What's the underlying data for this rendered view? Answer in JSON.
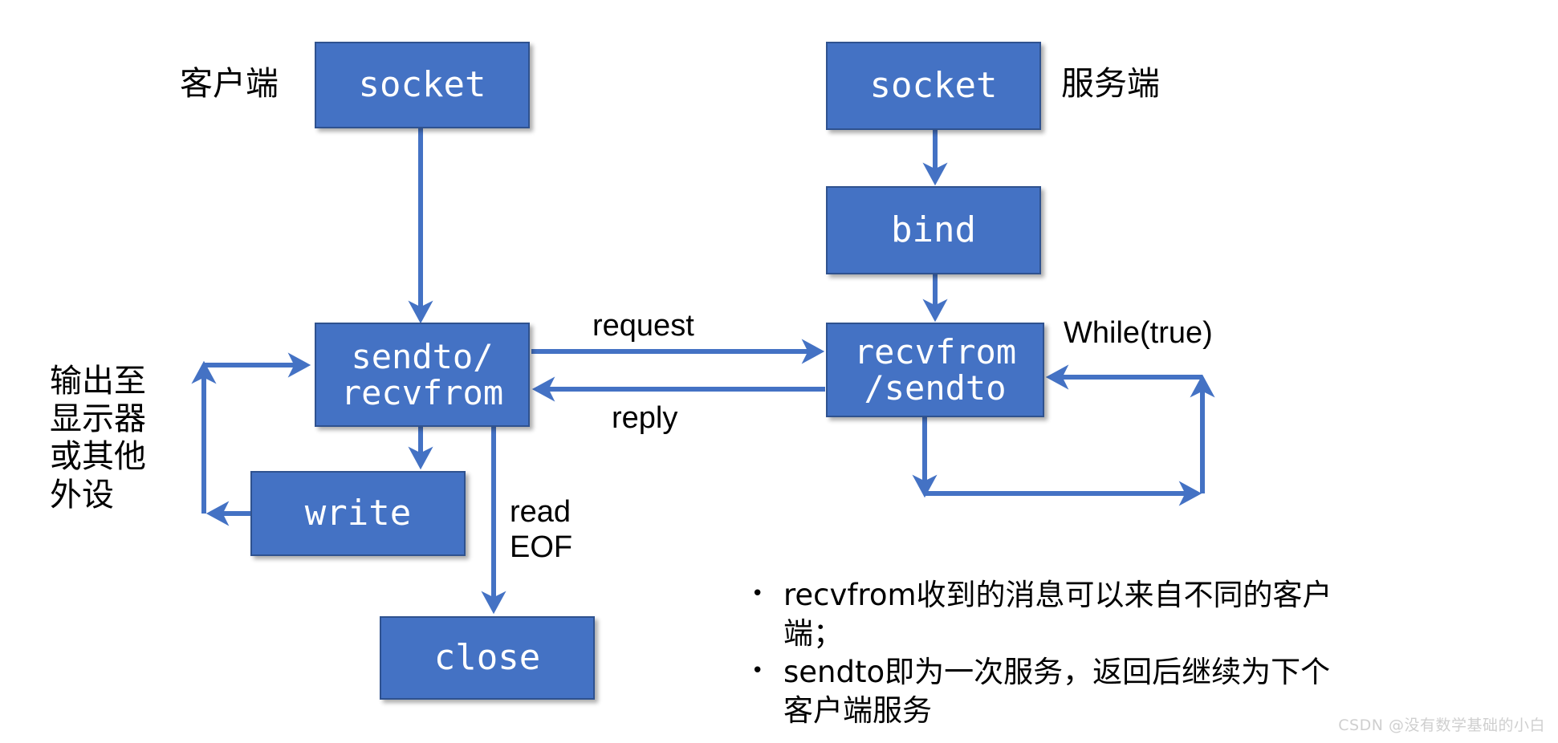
{
  "diagram": {
    "title": "UDP socket client-server flow",
    "colors": {
      "box_fill": "#4472C4",
      "box_border": "#2F528F",
      "arrow": "#4472C4",
      "text_dark": "#000000",
      "box_text": "#FFFFFF",
      "watermark": "#CFCFCF",
      "background": "#FFFFFF"
    },
    "side_labels": {
      "client": "客户端",
      "server": "服务端"
    },
    "nodes": {
      "client_socket": "socket",
      "client_sendto_recvfrom": "sendto/\nrecvfrom",
      "client_write": "write",
      "client_close": "close",
      "server_socket": "socket",
      "server_bind": "bind",
      "server_recvfrom_sendto": "recvfrom\n/sendto"
    },
    "edge_labels": {
      "request": "request",
      "reply": "reply",
      "read_eof": "read\nEOF",
      "while_true": "While(true)",
      "output_device": "输出至\n显示器\n或其他\n外设"
    },
    "bullets": [
      {
        "marker": "•",
        "text": "recvfrom收到的消息可以来自不同的客户端；"
      },
      {
        "marker": "•",
        "text": "sendto即为一次服务，返回后继续为下个客户端服务"
      }
    ],
    "watermark": "CSDN @没有数学基础的小白"
  }
}
